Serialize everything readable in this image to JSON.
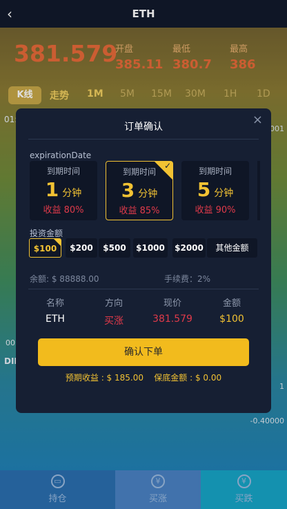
{
  "header": {
    "back_icon": "‹",
    "title": "ETH"
  },
  "ticker": {
    "price": "381.579",
    "open_label": "开盘",
    "open_value": "385.11",
    "low_label": "最低",
    "low_value": "380.7",
    "high_label": "最高",
    "high_value": "386"
  },
  "chart_tabs": [
    "K线",
    "走势",
    "1M",
    "5M",
    "15M",
    "30M",
    "1H",
    "1D"
  ],
  "behind": {
    "time_label": "01:",
    "right_values": [
      "001",
      "1",
      "-0.40000"
    ],
    "left_values": [
      "00",
      "DII"
    ]
  },
  "nav": {
    "items": [
      {
        "label": "持仓",
        "icon": "wallet-icon"
      },
      {
        "label": "买涨",
        "icon": "yen-up-icon"
      },
      {
        "label": "买跌",
        "icon": "yen-down-icon"
      }
    ]
  },
  "modal": {
    "title": "订单确认",
    "close_icon": "×",
    "expiration_label": "expirationDate",
    "expiration_options": [
      {
        "label": "到期时间",
        "value": "1",
        "unit": "分钟",
        "profit": "收益 80%"
      },
      {
        "label": "到期时间",
        "value": "3",
        "unit": "分钟",
        "profit": "收益 85%"
      },
      {
        "label": "到期时间",
        "value": "5",
        "unit": "分钟",
        "profit": "收益 90%"
      }
    ],
    "amount_label": "投资金额",
    "amounts": [
      "$100",
      "$200",
      "$500",
      "$1000",
      "$2000",
      "其他金额"
    ],
    "balance": "余额: $ 88888.00",
    "fee": "手续费：2%",
    "table": {
      "headers": [
        "名称",
        "方向",
        "现价",
        "金额"
      ],
      "row": [
        "ETH",
        "买涨",
        "381.579",
        "$100"
      ]
    },
    "confirm_label": "确认下单",
    "expected_profit": "预期收益 : $ 185.00",
    "margin": "保底金额 : $ 0.00"
  },
  "colors": {
    "accent": "#f2c233",
    "up": "#e03a4a",
    "bg": "#161f33"
  }
}
